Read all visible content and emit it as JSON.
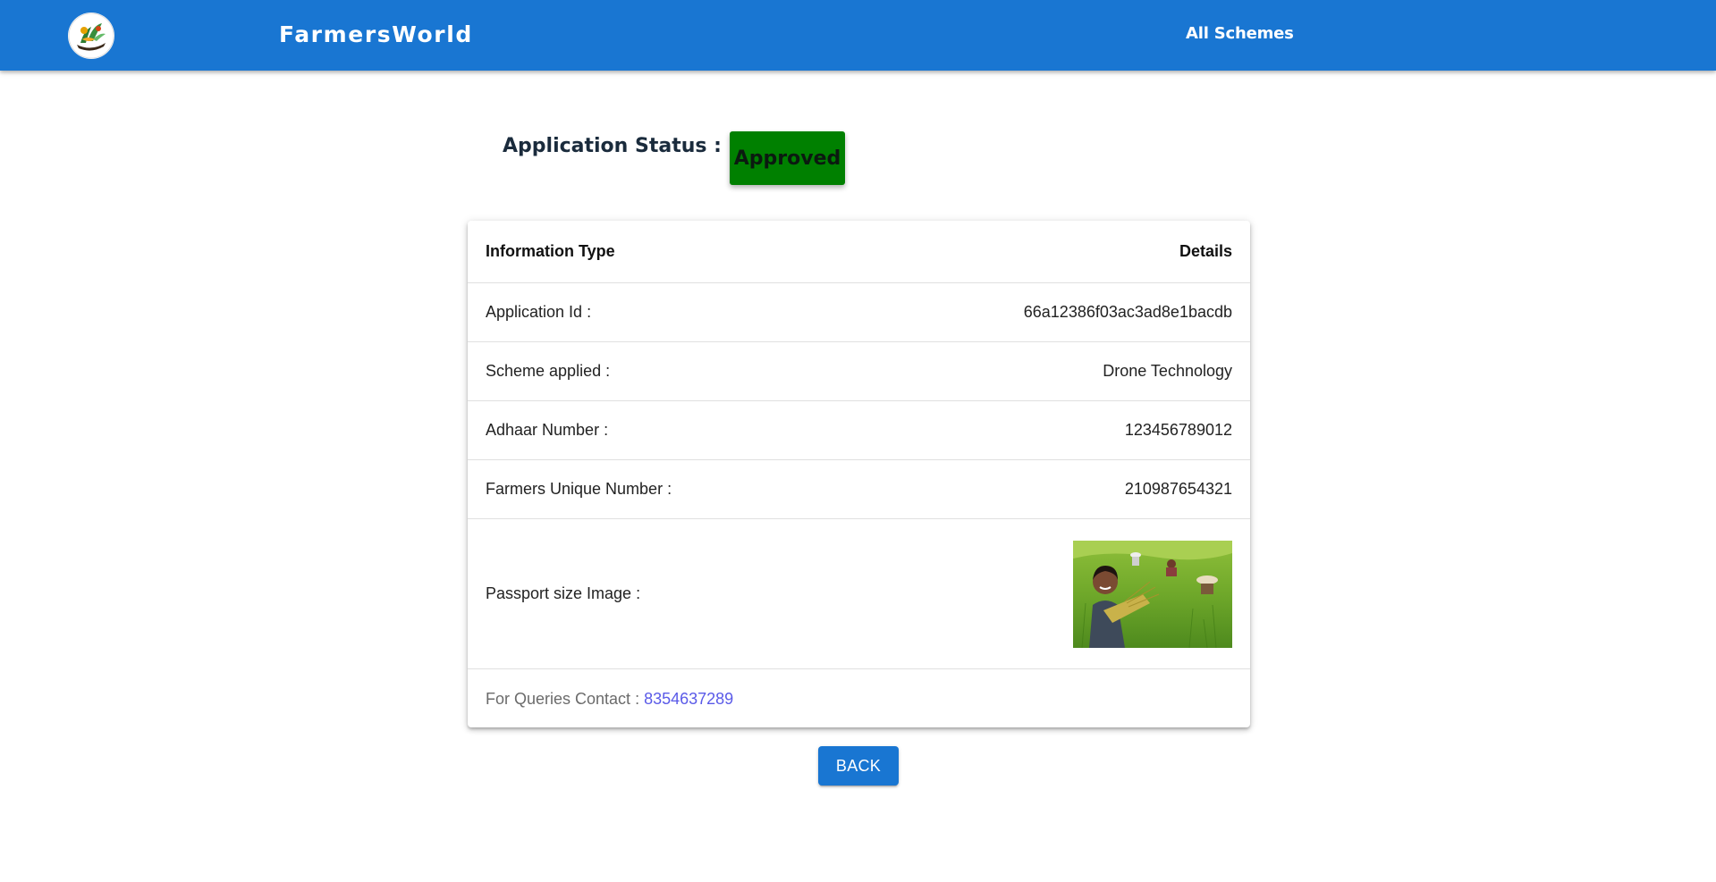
{
  "header": {
    "brand": "FarmersWorld",
    "nav_all_schemes": "All Schemes"
  },
  "status": {
    "label": "Application Status :",
    "value": "Approved",
    "color": "#008000"
  },
  "table": {
    "col_type": "Information Type",
    "col_details": "Details",
    "rows": [
      {
        "label": "Application Id :",
        "value": "66a12386f03ac3ad8e1bacdb"
      },
      {
        "label": "Scheme applied :",
        "value": "Drone Technology"
      },
      {
        "label": "Adhaar Number :",
        "value": "123456789012"
      },
      {
        "label": "Farmers Unique Number :",
        "value": "210987654321"
      }
    ],
    "image_label": "Passport size Image :",
    "contact_label": "For Queries Contact :",
    "contact_phone": "8354637289"
  },
  "actions": {
    "back_label": "BACK"
  },
  "colors": {
    "primary": "#1976d2",
    "link": "#5a5ae8"
  }
}
